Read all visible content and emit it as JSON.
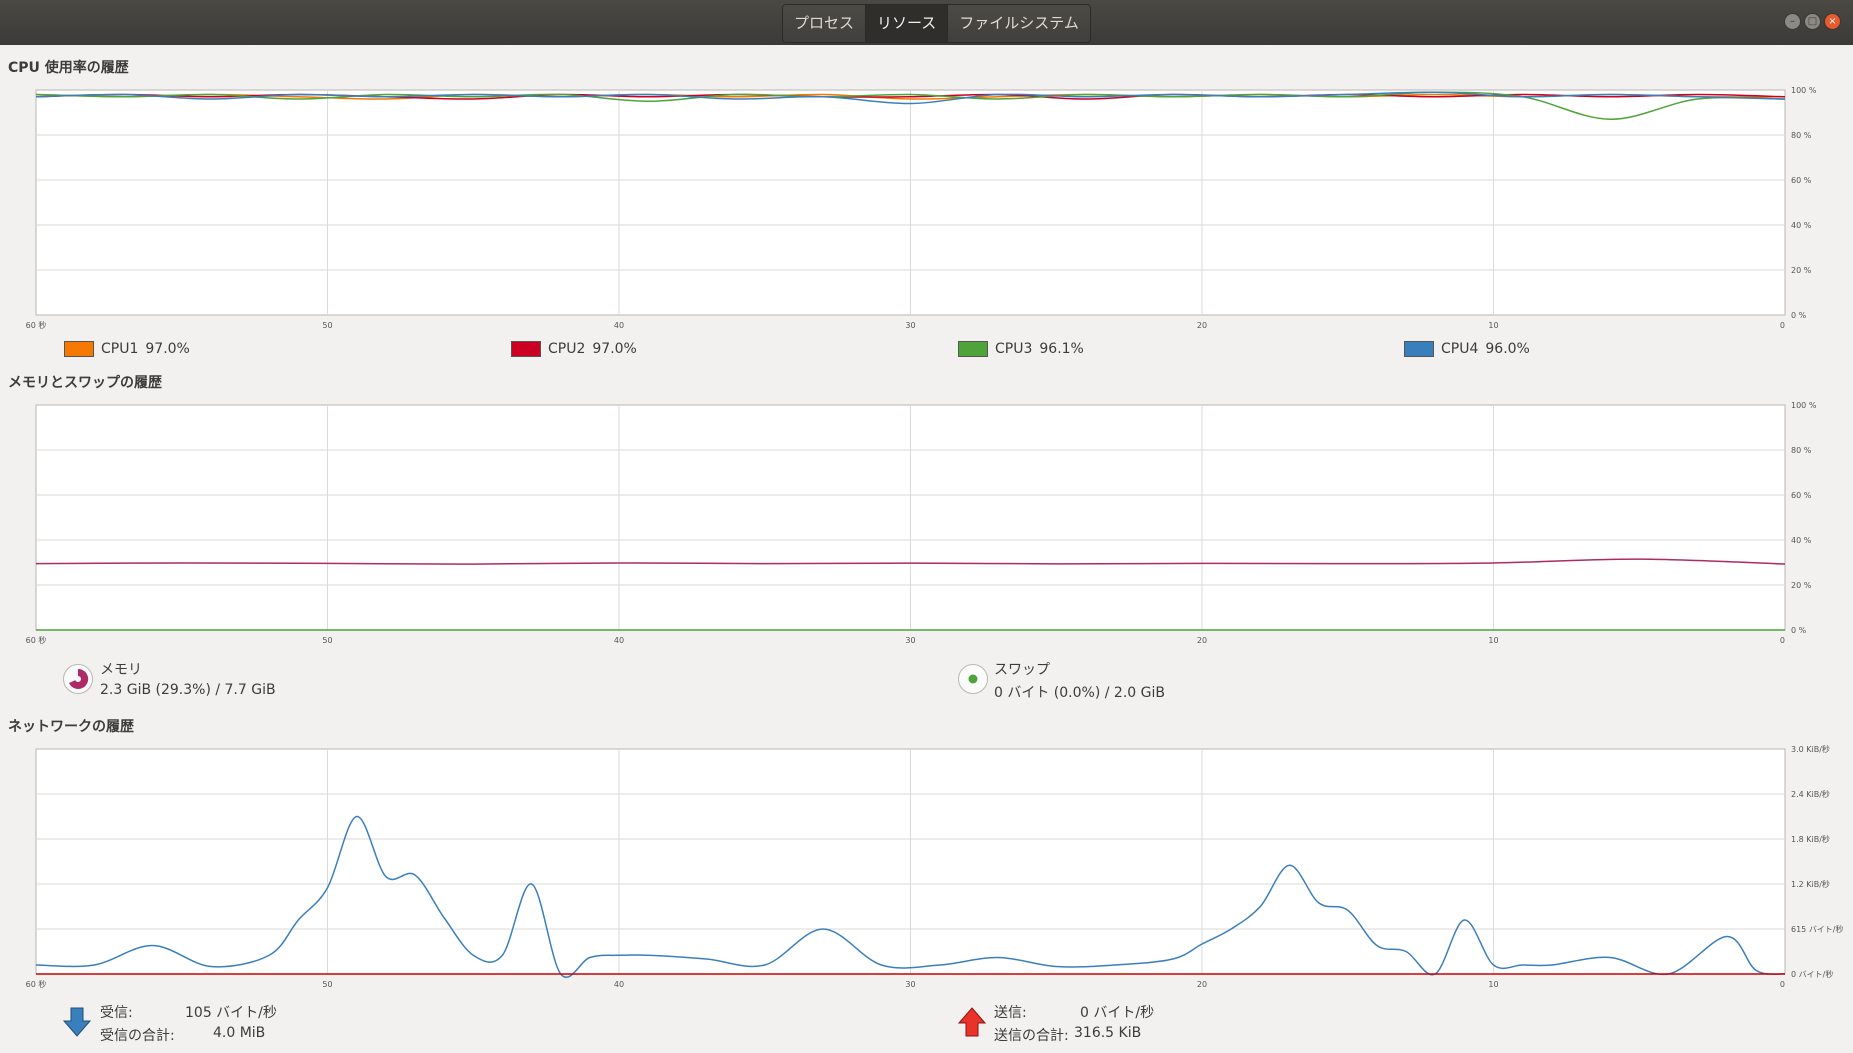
{
  "tabs": [
    {
      "label": "プロセス",
      "active": false
    },
    {
      "label": "リソース",
      "active": true
    },
    {
      "label": "ファイルシステム",
      "active": false
    }
  ],
  "window_buttons": {
    "minimize_glyph": "–",
    "maximize_glyph": "□",
    "close_glyph": "×"
  },
  "cpu": {
    "title": "CPU 使用率の履歴",
    "legend": [
      {
        "name": "CPU1",
        "value": "97.0%",
        "color": "#f57900"
      },
      {
        "name": "CPU2",
        "value": "97.0%",
        "color": "#cc0022"
      },
      {
        "name": "CPU3",
        "value": "96.1%",
        "color": "#4ea33a"
      },
      {
        "name": "CPU4",
        "value": "96.0%",
        "color": "#3a7fbd"
      }
    ]
  },
  "memory": {
    "title": "メモリとスワップの履歴",
    "mem_label": "メモリ",
    "mem_value": "2.3 GiB (29.3%) / 7.7 GiB",
    "mem_color": "#ad2a66",
    "swap_label": "スワップ",
    "swap_value": "0 バイト (0.0%) / 2.0 GiB",
    "swap_color": "#4ea33a"
  },
  "network": {
    "title": "ネットワークの履歴",
    "recv_label": "受信:",
    "recv_value": "105 バイト/秒",
    "recv_total_label": "受信の合計:",
    "recv_total_value": "4.0 MiB",
    "send_label": "送信:",
    "send_value": "0 バイト/秒",
    "send_total_label": "送信の合計:",
    "send_total_value": "316.5 KiB",
    "recv_color": "#3a7fbd",
    "send_color": "#cc0000"
  },
  "chart_data": [
    {
      "type": "line",
      "title": "CPU 使用率の履歴",
      "x_ticks": [
        "60 秒",
        "50",
        "40",
        "30",
        "20",
        "10",
        "0"
      ],
      "y_ticks": [
        "100 %",
        "80 %",
        "60 %",
        "40 %",
        "20 %",
        "0 %"
      ],
      "xlim": [
        60,
        0
      ],
      "ylim": [
        0,
        100
      ],
      "x": [
        60,
        57,
        54,
        51,
        48,
        45,
        42,
        39,
        36,
        33,
        30,
        27,
        24,
        21,
        18,
        15,
        12,
        9,
        6,
        3,
        0
      ],
      "series": [
        {
          "name": "CPU1",
          "values": [
            98,
            97,
            98,
            97,
            96,
            98,
            97,
            98,
            97,
            98,
            96,
            97,
            98,
            97,
            98,
            97,
            98,
            97,
            98,
            97,
            97
          ]
        },
        {
          "name": "CPU2",
          "values": [
            97,
            98,
            97,
            98,
            97,
            96,
            98,
            97,
            98,
            97,
            97,
            98,
            96,
            98,
            97,
            98,
            97,
            98,
            97,
            98,
            97
          ]
        },
        {
          "name": "CPU3",
          "values": [
            98,
            97,
            98,
            96,
            98,
            97,
            98,
            95,
            98,
            97,
            98,
            96,
            98,
            97,
            98,
            97,
            99,
            97,
            87,
            96,
            96
          ]
        },
        {
          "name": "CPU4",
          "values": [
            97,
            98,
            96,
            98,
            97,
            98,
            97,
            98,
            96,
            97,
            94,
            98,
            97,
            98,
            97,
            98,
            99,
            97,
            98,
            97,
            96
          ]
        }
      ]
    },
    {
      "type": "line",
      "title": "メモリとスワップの履歴",
      "x_ticks": [
        "60 秒",
        "50",
        "40",
        "30",
        "20",
        "10",
        "0"
      ],
      "y_ticks": [
        "100 %",
        "80 %",
        "60 %",
        "40 %",
        "20 %",
        "0 %"
      ],
      "xlim": [
        60,
        0
      ],
      "ylim": [
        0,
        100
      ],
      "x": [
        60,
        55,
        50,
        45,
        40,
        35,
        30,
        25,
        20,
        15,
        10,
        5,
        0
      ],
      "series": [
        {
          "name": "メモリ",
          "values": [
            29.5,
            29.8,
            29.6,
            29.3,
            29.8,
            29.5,
            29.7,
            29.4,
            29.6,
            29.5,
            29.8,
            31.5,
            29.3
          ]
        },
        {
          "name": "スワップ",
          "values": [
            0,
            0,
            0,
            0,
            0,
            0,
            0,
            0,
            0,
            0,
            0,
            0,
            0
          ]
        }
      ]
    },
    {
      "type": "line",
      "title": "ネットワークの履歴",
      "x_ticks": [
        "60 秒",
        "50",
        "40",
        "30",
        "20",
        "10",
        "0"
      ],
      "y_ticks": [
        "3.0 KiB/秒",
        "2.4 KiB/秒",
        "1.8 KiB/秒",
        "1.2 KiB/秒",
        "615 バイト/秒",
        "0 バイト/秒"
      ],
      "xlim": [
        60,
        0
      ],
      "ylim": [
        0,
        3.0
      ],
      "x": [
        60,
        58,
        56,
        54,
        52,
        51,
        50,
        49,
        48,
        47,
        46,
        45,
        44,
        43,
        42,
        41,
        40,
        39,
        37,
        35,
        33,
        31,
        29,
        27,
        25,
        23,
        21,
        20,
        19,
        18,
        17,
        16,
        15,
        14,
        13,
        12,
        11,
        10,
        9,
        8,
        6,
        4,
        2,
        1,
        0
      ],
      "series": [
        {
          "name": "受信",
          "values": [
            0.12,
            0.12,
            0.38,
            0.1,
            0.25,
            0.72,
            1.15,
            2.1,
            1.3,
            1.32,
            0.75,
            0.25,
            0.25,
            1.2,
            0.0,
            0.22,
            0.25,
            0.25,
            0.2,
            0.12,
            0.6,
            0.12,
            0.12,
            0.22,
            0.1,
            0.12,
            0.2,
            0.4,
            0.6,
            0.9,
            1.45,
            0.95,
            0.85,
            0.38,
            0.3,
            0.0,
            0.72,
            0.12,
            0.12,
            0.12,
            0.22,
            0.0,
            0.5,
            0.05,
            0.0
          ]
        },
        {
          "name": "送信",
          "values": [
            0,
            0,
            0,
            0,
            0,
            0,
            0,
            0,
            0,
            0,
            0,
            0,
            0,
            0,
            0,
            0,
            0,
            0,
            0,
            0,
            0,
            0,
            0,
            0,
            0,
            0,
            0,
            0,
            0,
            0,
            0,
            0,
            0,
            0,
            0,
            0,
            0,
            0,
            0,
            0,
            0,
            0,
            0,
            0,
            0
          ]
        }
      ]
    }
  ]
}
